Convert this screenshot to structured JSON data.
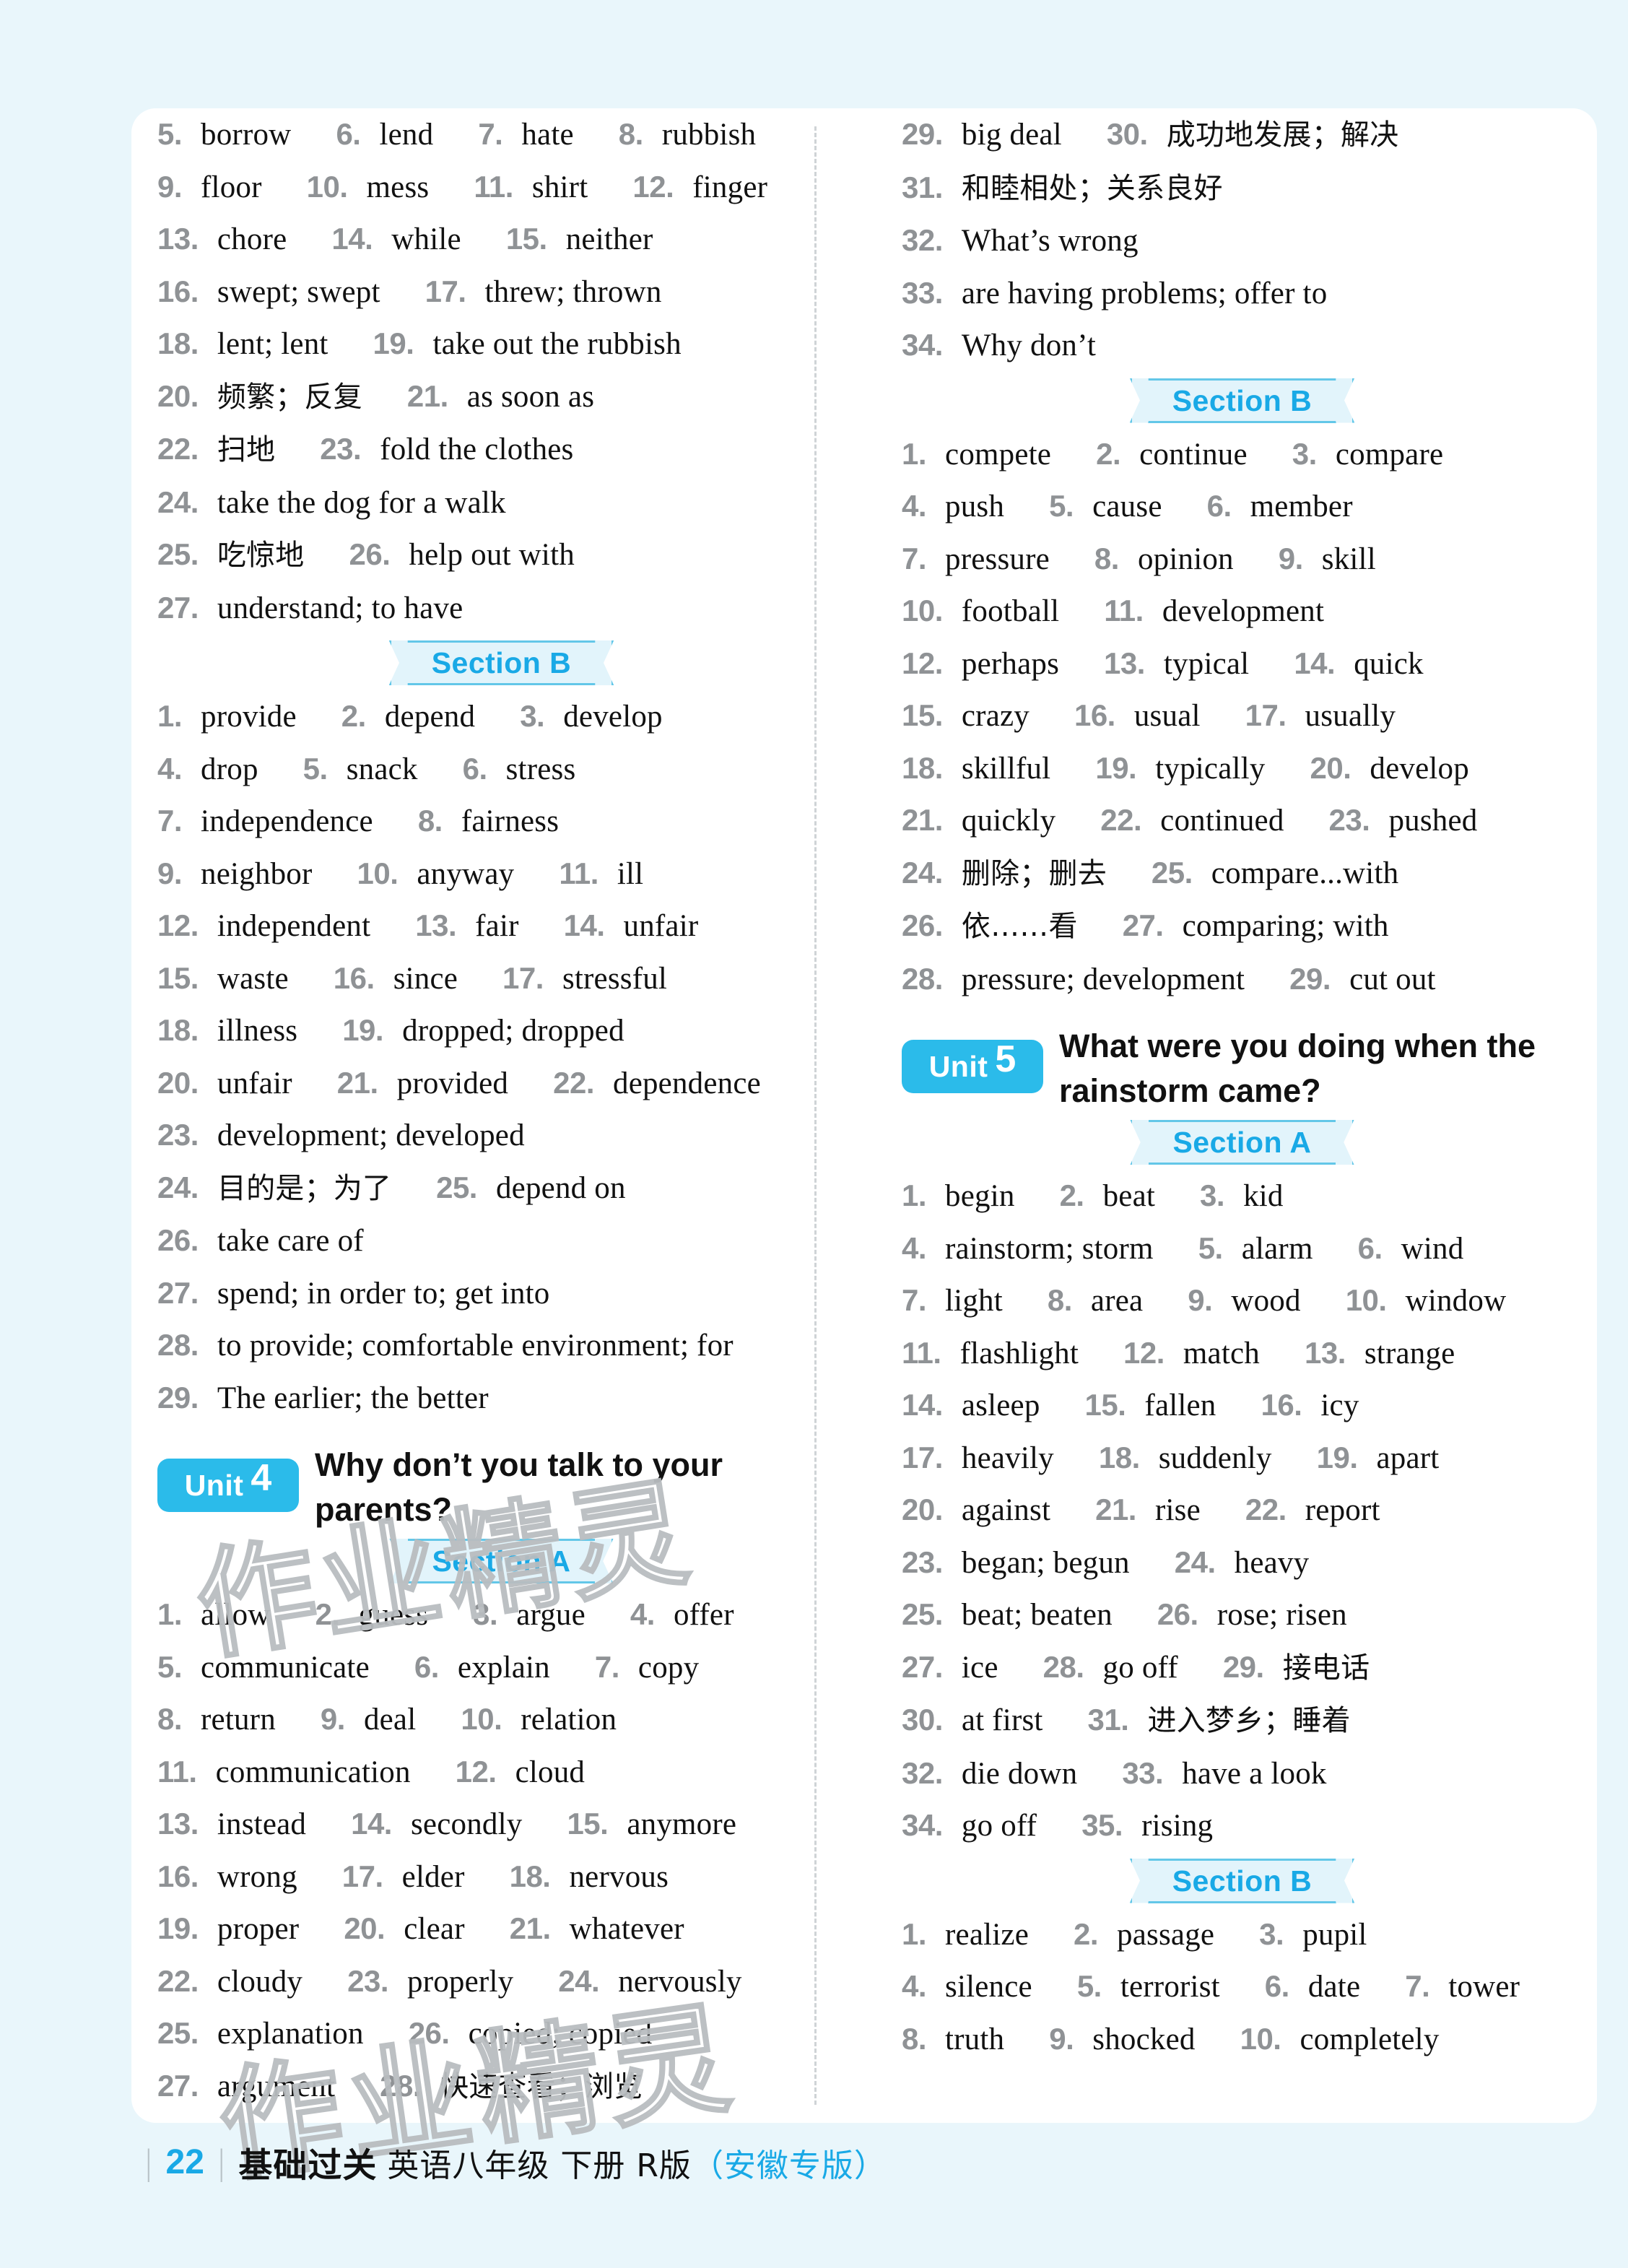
{
  "page": {
    "background_color": "#e9f6fb",
    "card_color": "#ffffff",
    "accent_color": "#19a9e6",
    "badge_color": "#2bbbea",
    "number_color": "#8f9295"
  },
  "watermarks": {
    "one": "作业精灵",
    "two": "作业精灵"
  },
  "left_column": {
    "continued_answers": [
      {
        "n": "5.",
        "a": "borrow"
      },
      {
        "n": "6.",
        "a": "lend"
      },
      {
        "n": "7.",
        "a": "hate"
      },
      {
        "n": "8.",
        "a": "rubbish"
      },
      {
        "n": "9.",
        "a": "floor"
      },
      {
        "n": "10.",
        "a": "mess"
      },
      {
        "n": "11.",
        "a": "shirt"
      },
      {
        "n": "12.",
        "a": "finger"
      },
      {
        "n": "13.",
        "a": "chore"
      },
      {
        "n": "14.",
        "a": "while"
      },
      {
        "n": "15.",
        "a": "neither"
      },
      {
        "n": "16.",
        "a": "swept; swept"
      },
      {
        "n": "17.",
        "a": "threw; thrown"
      },
      {
        "n": "18.",
        "a": "lent; lent"
      },
      {
        "n": "19.",
        "a": "take out the rubbish"
      },
      {
        "n": "20.",
        "a": "频繁；反复"
      },
      {
        "n": "21.",
        "a": "as soon as"
      },
      {
        "n": "22.",
        "a": "扫地"
      },
      {
        "n": "23.",
        "a": "fold the clothes"
      },
      {
        "n": "24.",
        "a": "take the dog for a walk"
      },
      {
        "n": "25.",
        "a": "吃惊地"
      },
      {
        "n": "26.",
        "a": "help out with"
      },
      {
        "n": "27.",
        "a": "understand; to have"
      }
    ],
    "section_b_label": "Section B",
    "section_b_answers": [
      {
        "n": "1.",
        "a": "provide"
      },
      {
        "n": "2.",
        "a": "depend"
      },
      {
        "n": "3.",
        "a": "develop"
      },
      {
        "n": "4.",
        "a": "drop"
      },
      {
        "n": "5.",
        "a": "snack"
      },
      {
        "n": "6.",
        "a": "stress"
      },
      {
        "n": "7.",
        "a": "independence"
      },
      {
        "n": "8.",
        "a": "fairness"
      },
      {
        "n": "9.",
        "a": "neighbor"
      },
      {
        "n": "10.",
        "a": "anyway"
      },
      {
        "n": "11.",
        "a": "ill"
      },
      {
        "n": "12.",
        "a": "independent"
      },
      {
        "n": "13.",
        "a": "fair"
      },
      {
        "n": "14.",
        "a": "unfair"
      },
      {
        "n": "15.",
        "a": "waste"
      },
      {
        "n": "16.",
        "a": "since"
      },
      {
        "n": "17.",
        "a": "stressful"
      },
      {
        "n": "18.",
        "a": "illness"
      },
      {
        "n": "19.",
        "a": "dropped; dropped"
      },
      {
        "n": "20.",
        "a": "unfair"
      },
      {
        "n": "21.",
        "a": "provided"
      },
      {
        "n": "22.",
        "a": "dependence"
      },
      {
        "n": "23.",
        "a": "development; developed"
      },
      {
        "n": "24.",
        "a": "目的是；为了"
      },
      {
        "n": "25.",
        "a": "depend on"
      },
      {
        "n": "26.",
        "a": "take care of"
      },
      {
        "n": "27.",
        "a": "spend; in order to; get into"
      },
      {
        "n": "28.",
        "a": "to provide; comfortable environment; for"
      },
      {
        "n": "29.",
        "a": "The earlier; the better"
      }
    ],
    "unit": {
      "word": "Unit",
      "number": "4",
      "title": "Why don’t you talk to your parents?"
    },
    "section_a_label": "Section A",
    "section_a_answers": [
      {
        "n": "1.",
        "a": "allow"
      },
      {
        "n": "2.",
        "a": "guess"
      },
      {
        "n": "3.",
        "a": "argue"
      },
      {
        "n": "4.",
        "a": "offer"
      },
      {
        "n": "5.",
        "a": "communicate"
      },
      {
        "n": "6.",
        "a": "explain"
      },
      {
        "n": "7.",
        "a": "copy"
      },
      {
        "n": "8.",
        "a": "return"
      },
      {
        "n": "9.",
        "a": "deal"
      },
      {
        "n": "10.",
        "a": "relation"
      },
      {
        "n": "11.",
        "a": "communication"
      },
      {
        "n": "12.",
        "a": "cloud"
      },
      {
        "n": "13.",
        "a": "instead"
      },
      {
        "n": "14.",
        "a": "secondly"
      },
      {
        "n": "15.",
        "a": "anymore"
      },
      {
        "n": "16.",
        "a": "wrong"
      },
      {
        "n": "17.",
        "a": "elder"
      },
      {
        "n": "18.",
        "a": "nervous"
      },
      {
        "n": "19.",
        "a": "proper"
      },
      {
        "n": "20.",
        "a": "clear"
      },
      {
        "n": "21.",
        "a": "whatever"
      },
      {
        "n": "22.",
        "a": "cloudy"
      },
      {
        "n": "23.",
        "a": "properly"
      },
      {
        "n": "24.",
        "a": "nervously"
      },
      {
        "n": "25.",
        "a": "explanation"
      },
      {
        "n": "26.",
        "a": "copied; copied"
      },
      {
        "n": "27.",
        "a": "argument"
      },
      {
        "n": "28.",
        "a": "快速查看；浏览"
      }
    ]
  },
  "right_column": {
    "continued_answers": [
      {
        "n": "29.",
        "a": "big deal"
      },
      {
        "n": "30.",
        "a": "成功地发展；解决"
      },
      {
        "n": "31.",
        "a": "和睦相处；关系良好"
      },
      {
        "n": "32.",
        "a": "What’s wrong"
      },
      {
        "n": "33.",
        "a": "are having problems; offer to"
      },
      {
        "n": "34.",
        "a": "Why don’t"
      }
    ],
    "section_b_label": "Section B",
    "section_b_answers": [
      {
        "n": "1.",
        "a": "compete"
      },
      {
        "n": "2.",
        "a": "continue"
      },
      {
        "n": "3.",
        "a": "compare"
      },
      {
        "n": "4.",
        "a": "push"
      },
      {
        "n": "5.",
        "a": "cause"
      },
      {
        "n": "6.",
        "a": "member"
      },
      {
        "n": "7.",
        "a": "pressure"
      },
      {
        "n": "8.",
        "a": "opinion"
      },
      {
        "n": "9.",
        "a": "skill"
      },
      {
        "n": "10.",
        "a": "football"
      },
      {
        "n": "11.",
        "a": "development"
      },
      {
        "n": "12.",
        "a": "perhaps"
      },
      {
        "n": "13.",
        "a": "typical"
      },
      {
        "n": "14.",
        "a": "quick"
      },
      {
        "n": "15.",
        "a": "crazy"
      },
      {
        "n": "16.",
        "a": "usual"
      },
      {
        "n": "17.",
        "a": "usually"
      },
      {
        "n": "18.",
        "a": "skillful"
      },
      {
        "n": "19.",
        "a": "typically"
      },
      {
        "n": "20.",
        "a": "develop"
      },
      {
        "n": "21.",
        "a": "quickly"
      },
      {
        "n": "22.",
        "a": "continued"
      },
      {
        "n": "23.",
        "a": "pushed"
      },
      {
        "n": "24.",
        "a": "删除；删去"
      },
      {
        "n": "25.",
        "a": "compare...with"
      },
      {
        "n": "26.",
        "a": "依……看"
      },
      {
        "n": "27.",
        "a": "comparing; with"
      },
      {
        "n": "28.",
        "a": "pressure; development"
      },
      {
        "n": "29.",
        "a": "cut out"
      }
    ],
    "unit": {
      "word": "Unit",
      "number": "5",
      "title": "What were you doing when the rainstorm came?"
    },
    "section_a_label": "Section A",
    "section_a_answers": [
      {
        "n": "1.",
        "a": "begin"
      },
      {
        "n": "2.",
        "a": "beat"
      },
      {
        "n": "3.",
        "a": "kid"
      },
      {
        "n": "4.",
        "a": "rainstorm; storm"
      },
      {
        "n": "5.",
        "a": "alarm"
      },
      {
        "n": "6.",
        "a": "wind"
      },
      {
        "n": "7.",
        "a": "light"
      },
      {
        "n": "8.",
        "a": "area"
      },
      {
        "n": "9.",
        "a": "wood"
      },
      {
        "n": "10.",
        "a": "window"
      },
      {
        "n": "11.",
        "a": "flashlight"
      },
      {
        "n": "12.",
        "a": "match"
      },
      {
        "n": "13.",
        "a": "strange"
      },
      {
        "n": "14.",
        "a": "asleep"
      },
      {
        "n": "15.",
        "a": "fallen"
      },
      {
        "n": "16.",
        "a": "icy"
      },
      {
        "n": "17.",
        "a": "heavily"
      },
      {
        "n": "18.",
        "a": "suddenly"
      },
      {
        "n": "19.",
        "a": "apart"
      },
      {
        "n": "20.",
        "a": "against"
      },
      {
        "n": "21.",
        "a": "rise"
      },
      {
        "n": "22.",
        "a": "report"
      },
      {
        "n": "23.",
        "a": "began; begun"
      },
      {
        "n": "24.",
        "a": "heavy"
      },
      {
        "n": "25.",
        "a": "beat; beaten"
      },
      {
        "n": "26.",
        "a": "rose; risen"
      },
      {
        "n": "27.",
        "a": "ice"
      },
      {
        "n": "28.",
        "a": "go off"
      },
      {
        "n": "29.",
        "a": "接电话"
      },
      {
        "n": "30.",
        "a": "at first"
      },
      {
        "n": "31.",
        "a": "进入梦乡；睡着"
      },
      {
        "n": "32.",
        "a": "die down"
      },
      {
        "n": "33.",
        "a": "have a look"
      },
      {
        "n": "34.",
        "a": "go off"
      },
      {
        "n": "35.",
        "a": "rising"
      }
    ],
    "section_b2_label": "Section B",
    "section_b2_answers": [
      {
        "n": "1.",
        "a": "realize"
      },
      {
        "n": "2.",
        "a": "passage"
      },
      {
        "n": "3.",
        "a": "pupil"
      },
      {
        "n": "4.",
        "a": "silence"
      },
      {
        "n": "5.",
        "a": "terrorist"
      },
      {
        "n": "6.",
        "a": "date"
      },
      {
        "n": "7.",
        "a": "tower"
      },
      {
        "n": "8.",
        "a": "truth"
      },
      {
        "n": "9.",
        "a": "shocked"
      },
      {
        "n": "10.",
        "a": "completely"
      }
    ]
  },
  "footer": {
    "page_number": "22",
    "brand": "基础过关",
    "subject": "英语八年级 下册 R版",
    "province": "（安徽专版）"
  },
  "layout": {
    "left_continued_rows": [
      [
        0,
        1,
        2,
        3
      ],
      [
        4,
        5,
        6,
        7
      ],
      [
        8,
        9,
        10
      ],
      [
        11,
        12
      ],
      [
        13,
        14
      ],
      [
        15,
        16
      ],
      [
        17,
        18
      ],
      [
        19
      ],
      [
        20,
        21
      ],
      [
        22
      ]
    ],
    "left_sectionb_rows": [
      [
        0,
        1,
        2
      ],
      [
        3,
        4,
        5
      ],
      [
        6,
        7
      ],
      [
        8,
        9,
        10
      ],
      [
        11,
        12,
        13
      ],
      [
        14,
        15,
        16
      ],
      [
        17,
        18
      ],
      [
        19,
        20,
        21
      ],
      [
        22
      ],
      [
        23,
        24
      ],
      [
        25
      ],
      [
        26
      ],
      [
        27
      ],
      [
        28
      ]
    ],
    "left_sectiona_rows": [
      [
        0,
        1,
        2,
        3
      ],
      [
        4,
        5,
        6
      ],
      [
        7,
        8,
        9
      ],
      [
        10,
        11
      ],
      [
        12,
        13,
        14
      ],
      [
        15,
        16,
        17
      ],
      [
        18,
        19,
        20
      ],
      [
        21,
        22,
        23
      ],
      [
        24,
        25
      ],
      [
        26,
        27
      ]
    ],
    "right_continued_rows": [
      [
        0,
        1
      ],
      [
        2
      ],
      [
        3
      ],
      [
        4
      ],
      [
        5
      ]
    ],
    "right_sectionb_rows": [
      [
        0,
        1,
        2
      ],
      [
        3,
        4,
        5
      ],
      [
        6,
        7,
        8
      ],
      [
        9,
        10
      ],
      [
        11,
        12,
        13
      ],
      [
        14,
        15,
        16
      ],
      [
        17,
        18,
        19
      ],
      [
        20,
        21,
        22
      ],
      [
        23,
        24
      ],
      [
        25,
        26
      ],
      [
        27,
        28
      ]
    ],
    "right_sectiona_rows": [
      [
        0,
        1,
        2
      ],
      [
        3,
        4,
        5
      ],
      [
        6,
        7,
        8,
        9
      ],
      [
        10,
        11,
        12
      ],
      [
        13,
        14,
        15
      ],
      [
        16,
        17,
        18
      ],
      [
        19,
        20,
        21
      ],
      [
        22,
        23
      ],
      [
        24,
        25
      ],
      [
        26,
        27,
        28
      ],
      [
        29,
        30
      ],
      [
        31,
        32
      ],
      [
        33,
        34
      ]
    ],
    "right_sectionb2_rows": [
      [
        0,
        1,
        2
      ],
      [
        3,
        4,
        5,
        6
      ],
      [
        7,
        8,
        9
      ]
    ]
  }
}
